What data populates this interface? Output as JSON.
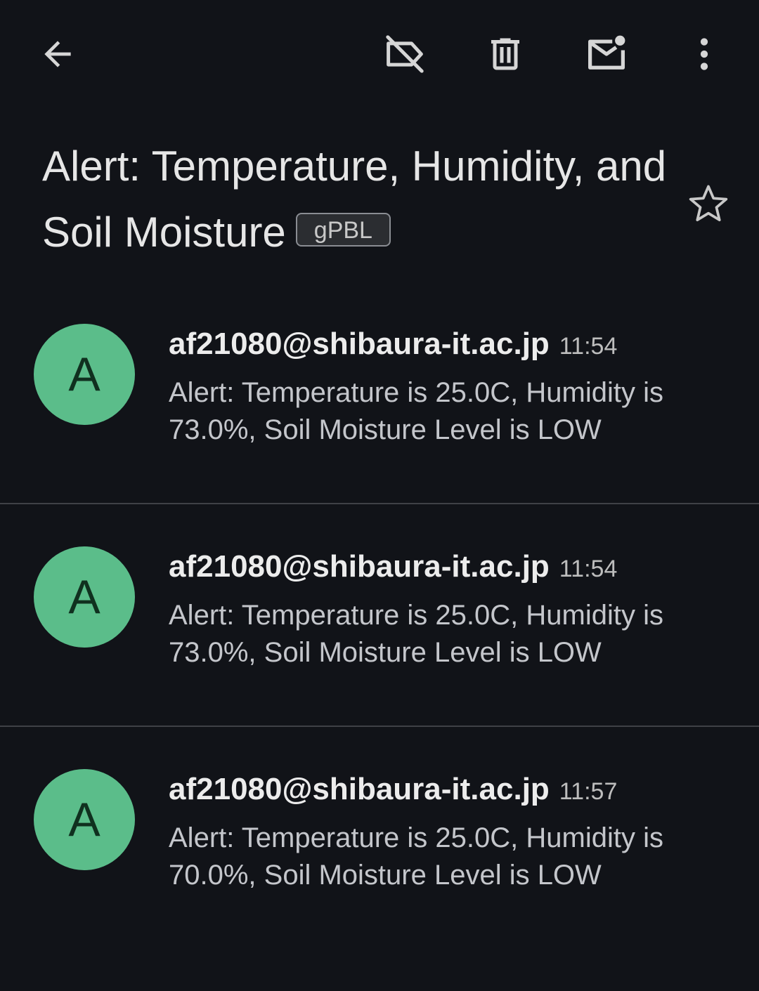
{
  "toolbar": {
    "back_icon": "arrow-left-icon",
    "remove_label_icon": "label-off-icon",
    "delete_icon": "trash-icon",
    "mark_unread_icon": "mail-unread-icon",
    "more_icon": "more-vert-icon"
  },
  "subject": {
    "title": "Alert: Temperature, Humidity, and Soil Moisture",
    "label": "gPBL",
    "star_icon": "star-outline-icon"
  },
  "messages": [
    {
      "avatar_letter": "A",
      "sender": "af21080@shibaura-it.ac.jp",
      "time": "11:54",
      "snippet": "Alert: Temperature is 25.0C, Humidity is 73.0%, Soil Moisture Level is LOW"
    },
    {
      "avatar_letter": "A",
      "sender": "af21080@shibaura-it.ac.jp",
      "time": "11:54",
      "snippet": "Alert: Temperature is 25.0C, Humidity is 73.0%, Soil Moisture Level is LOW"
    },
    {
      "avatar_letter": "A",
      "sender": "af21080@shibaura-it.ac.jp",
      "time": "11:57",
      "snippet": "Alert: Temperature is 25.0C, Humidity is 70.0%, Soil Moisture Level is LOW"
    }
  ],
  "colors": {
    "background": "#111318",
    "avatar": "#5bbd8a",
    "divider": "#3f4146"
  }
}
